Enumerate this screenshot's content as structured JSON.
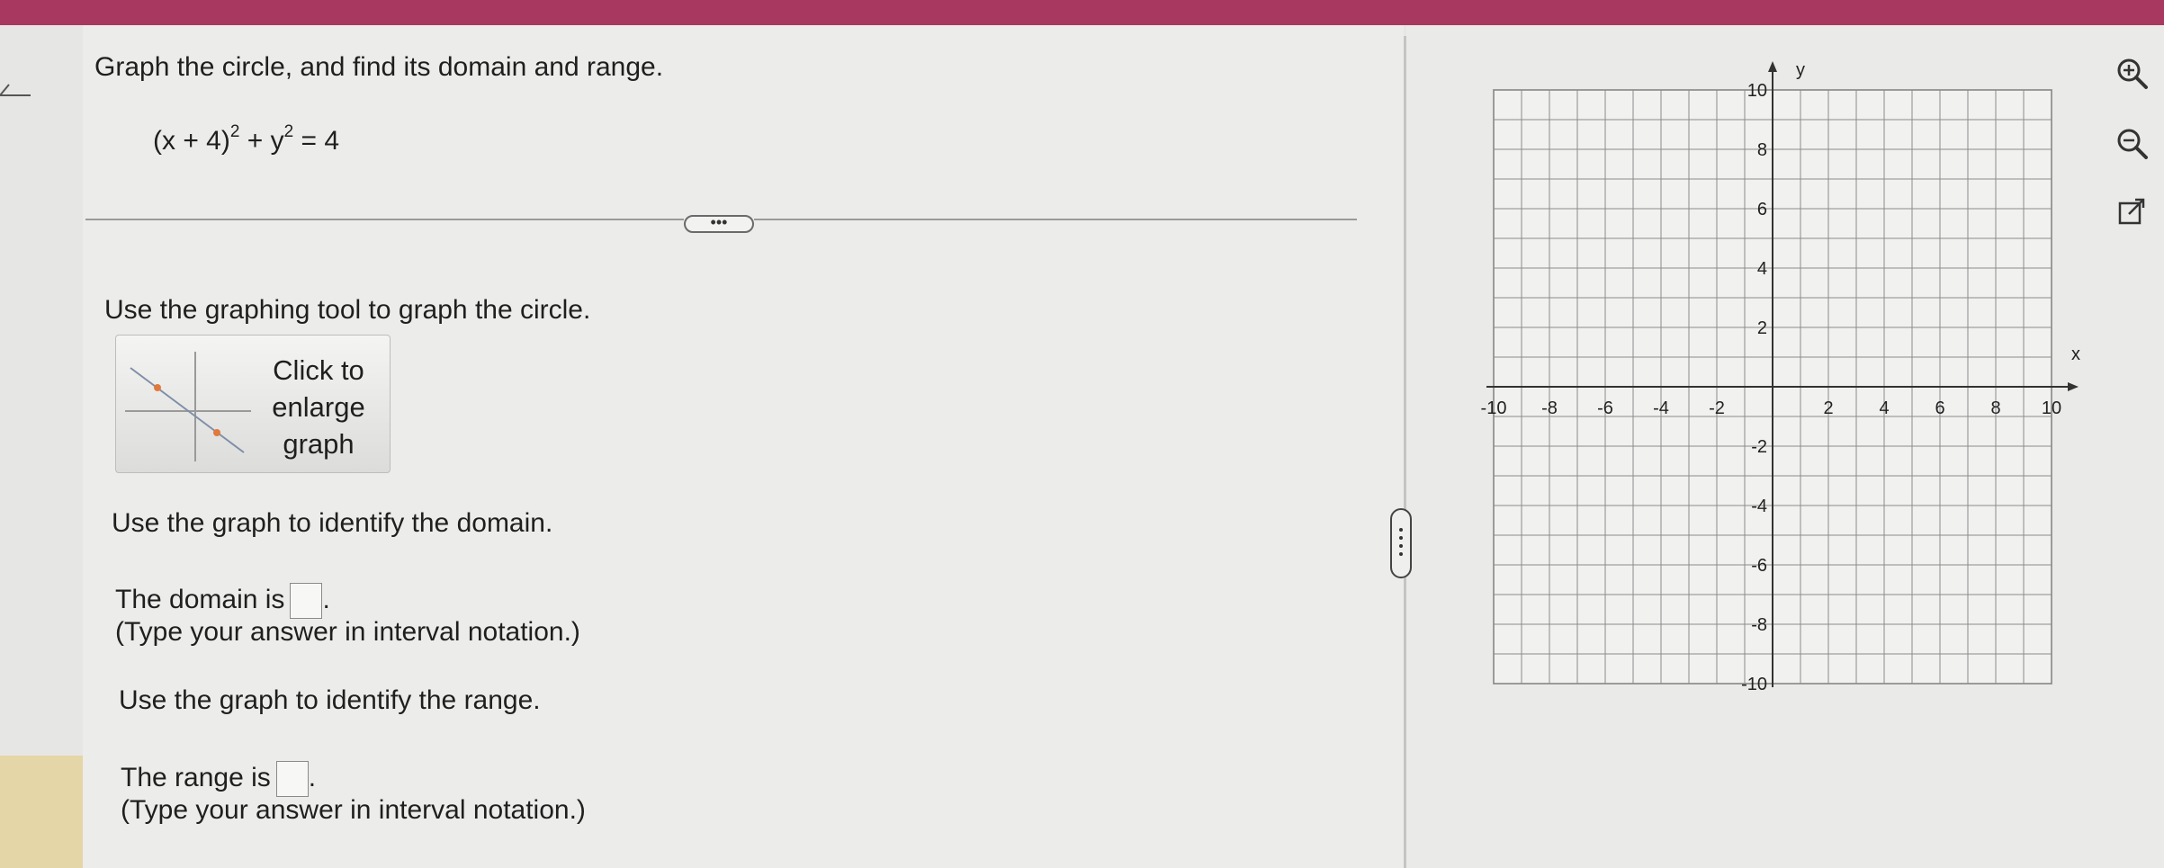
{
  "question": {
    "title": "Graph the circle, and find its domain and range.",
    "equation": {
      "base": "(x + 4)",
      "exp1": "2",
      "mid": " + y",
      "exp2": "2",
      "rhs": " = 4"
    },
    "more_label": "•••"
  },
  "graph_tool": {
    "instruction": "Use the graphing tool to graph the circle.",
    "thumbnail_label": [
      "Click to",
      "enlarge",
      "graph"
    ]
  },
  "domain": {
    "instruction": "Use the graph to identify the domain.",
    "prefix": "The domain is",
    "suffix": ".",
    "value": "",
    "hint": "(Type your answer in interval notation.)"
  },
  "range": {
    "instruction": "Use the graph to identify the range.",
    "prefix": "The range is",
    "suffix": ".",
    "value": "",
    "hint": "(Type your answer in interval notation.)"
  },
  "graph": {
    "x_axis_label": "x",
    "y_axis_label": "y",
    "x_range": [
      -10,
      10
    ],
    "y_range": [
      -10,
      10
    ],
    "x_tick_labels": [
      "-10",
      "-8",
      "-6",
      "-4",
      "-2",
      "2",
      "4",
      "6",
      "8",
      "10"
    ],
    "y_tick_labels": [
      "10",
      "8",
      "6",
      "4",
      "2",
      "-2",
      "-4",
      "-6",
      "-8",
      "-10"
    ],
    "grid": true
  },
  "tools": {
    "icons": [
      "zoom-in-icon",
      "zoom-out-icon",
      "external-link-icon"
    ]
  },
  "colors": {
    "top_bar": "#a8385f",
    "accent_orange": "#e07a3c"
  }
}
